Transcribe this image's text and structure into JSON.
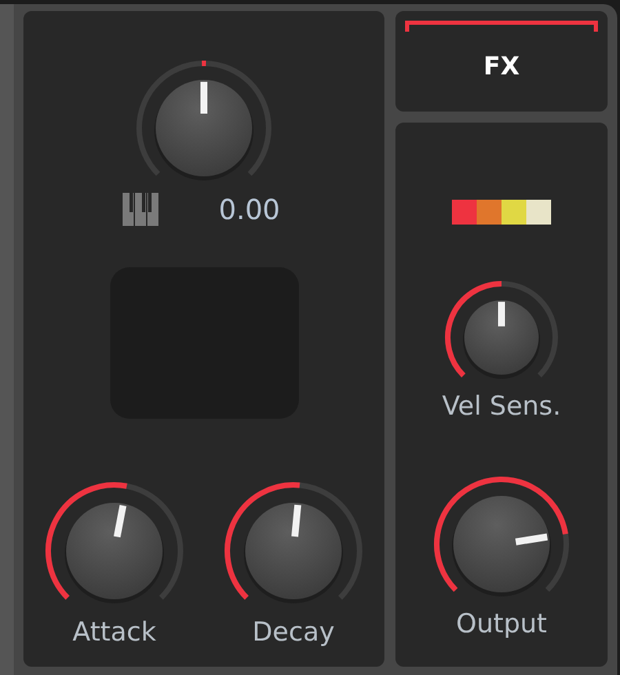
{
  "pitch": {
    "kind": "bipolar",
    "value": "0.00"
  },
  "envelope": [
    {
      "label": "Attack",
      "kind": "unipolar"
    },
    {
      "label": "Decay",
      "kind": "unipolar"
    }
  ],
  "fx_button": {
    "label": "FX",
    "selected": true
  },
  "velocity_colors": [
    {
      "color": "#ee3340"
    },
    {
      "color": "#e0762c"
    },
    {
      "color": "#e0d844"
    },
    {
      "color": "#e8e4c8"
    }
  ],
  "vel_sens": {
    "label": "Vel Sens.",
    "kind": "unipolar"
  },
  "output": {
    "label": "Output",
    "kind": "unipolar"
  }
}
